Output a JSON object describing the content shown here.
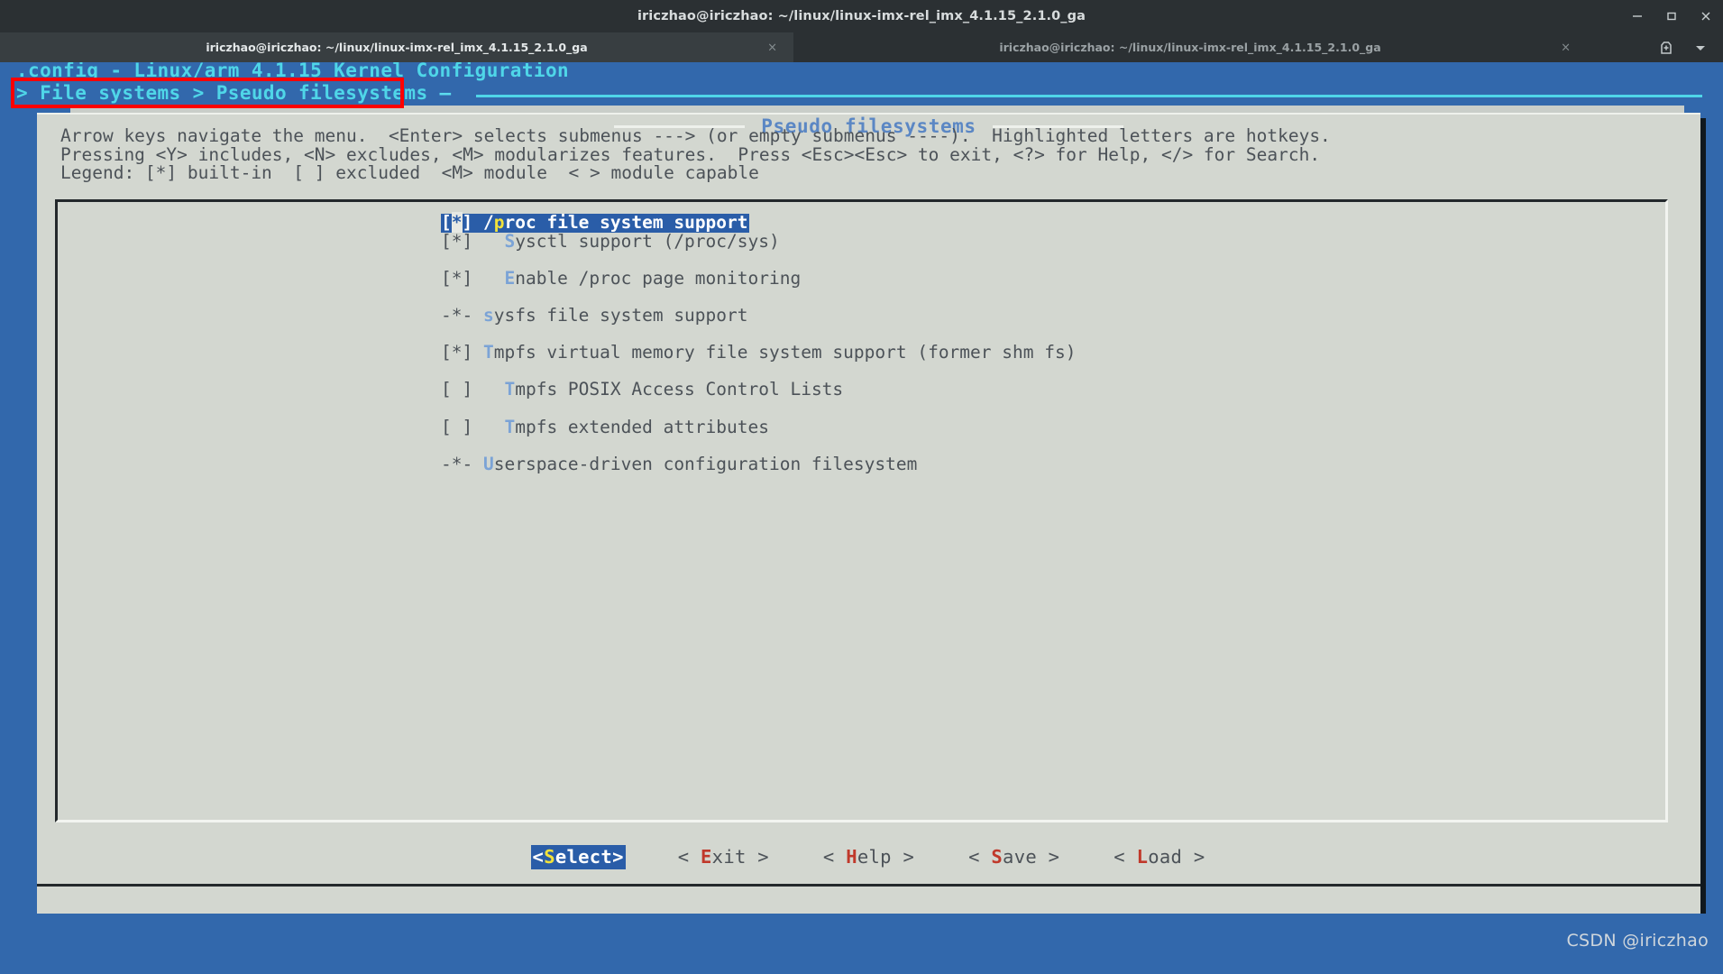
{
  "window": {
    "title": "iriczhao@iriczhao: ~/linux/linux-imx-rel_imx_4.1.15_2.1.0_ga",
    "controls": {
      "minimize": "minimize-icon",
      "maximize": "maximize-icon",
      "close": "close-icon"
    }
  },
  "tabs": {
    "items": [
      {
        "label": "iriczhao@iriczhao: ~/linux/linux-imx-rel_imx_4.1.15_2.1.0_ga",
        "close": "×",
        "active": true
      },
      {
        "label": "iriczhao@iriczhao: ~/linux/linux-imx-rel_imx_4.1.15_2.1.0_ga",
        "close": "×",
        "active": false
      }
    ],
    "new_tab_icon": "new-tab-icon",
    "menu_icon": "chevron-down-icon"
  },
  "menuconfig": {
    "header": ".config - Linux/arm 4.1.15 Kernel Configuration",
    "breadcrumb": "> File systems > Pseudo filesystems",
    "breadcrumb_dash": " —",
    "dialog_title": "Pseudo filesystems",
    "help_line1": "Arrow keys navigate the menu.  <Enter> selects submenus ---> (or empty submenus ----).  Highlighted letters are hotkeys.",
    "help_line2": "Pressing <Y> includes, <N> excludes, <M> modularizes features.  Press <Esc><Esc> to exit, <?> for Help, </> for Search.",
    "help_line3": "Legend: [*] built-in  [ ] excluded  <M> module  < > module capable",
    "items": [
      {
        "marker": "[*]",
        "indent": "",
        "hot": "/p",
        "hot_char": "p",
        "pre": "/",
        "rest": "roc file system support",
        "selected": true,
        "full": "[*] /proc file system support"
      },
      {
        "marker": "[*]",
        "indent": "  ",
        "hot_char": "S",
        "pre": "",
        "rest": "ysctl support (/proc/sys)",
        "selected": false,
        "full": "[*]   Sysctl support (/proc/sys)"
      },
      {
        "marker": "[*]",
        "indent": "  ",
        "hot_char": "E",
        "pre": "",
        "rest": "nable /proc page monitoring",
        "selected": false,
        "full": "[*]   Enable /proc page monitoring"
      },
      {
        "marker": "-*-",
        "indent": "",
        "hot_char": "s",
        "pre": "",
        "rest": "ysfs file system support",
        "selected": false,
        "full": "-*- sysfs file system support"
      },
      {
        "marker": "[*]",
        "indent": "",
        "hot_char": "T",
        "pre": "",
        "rest": "mpfs virtual memory file system support (former shm fs)",
        "selected": false,
        "full": "[*] Tmpfs virtual memory file system support (former shm fs)"
      },
      {
        "marker": "[ ]",
        "indent": "  ",
        "hot_char": "T",
        "pre": "",
        "rest": "mpfs POSIX Access Control Lists",
        "selected": false,
        "full": "[ ]   Tmpfs POSIX Access Control Lists"
      },
      {
        "marker": "[ ]",
        "indent": "  ",
        "hot_char": "T",
        "pre": "",
        "rest": "mpfs extended attributes",
        "selected": false,
        "full": "[ ]   Tmpfs extended attributes"
      },
      {
        "marker": "-*-",
        "indent": "",
        "hot_char": "U",
        "pre": "",
        "rest": "serspace-driven configuration filesystem",
        "selected": false,
        "full": "-*- Userspace-driven configuration filesystem"
      }
    ],
    "buttons": [
      {
        "open": "<",
        "hk": "S",
        "rest": "elect",
        "close": ">",
        "label": "<Select>",
        "selected": true
      },
      {
        "open": "< ",
        "hk": "E",
        "rest": "xit",
        "close": " >",
        "label": "< Exit >",
        "selected": false
      },
      {
        "open": "< ",
        "hk": "H",
        "rest": "elp",
        "close": " >",
        "label": "< Help >",
        "selected": false
      },
      {
        "open": "< ",
        "hk": "S",
        "rest": "ave",
        "close": " >",
        "label": "< Save >",
        "selected": false
      },
      {
        "open": "< ",
        "hk": "L",
        "rest": "oad",
        "close": " >",
        "label": "< Load >",
        "selected": false
      }
    ]
  },
  "watermark": "CSDN @iriczhao",
  "colors": {
    "accent_blue": "#3268ac",
    "dialog_bg": "#d3d7d0",
    "highlight": "#2a5da8",
    "cyan": "#4fd6e8",
    "hotkey_blue": "#7ba3d6",
    "hotkey_red": "#c0392b",
    "hotkey_yellow": "#f2e23a",
    "annotation_red": "#ff0000"
  }
}
